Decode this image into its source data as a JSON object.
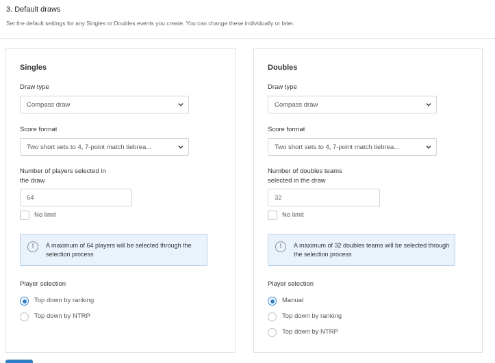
{
  "section": {
    "title": "3.  Default draws",
    "description": "Set the default settings for any Singles or Doubles events you create. You can change these individually or later."
  },
  "singles": {
    "title": "Singles",
    "draw_type_label": "Draw type",
    "draw_type_value": "Compass draw",
    "score_format_label": "Score format",
    "score_format_value": "Two short sets to 4, 7-point match tiebrea...",
    "count_label_line1": "Number of players selected in",
    "count_label_line2": "the draw",
    "count_value": "64",
    "no_limit_label": "No limit",
    "info_text": "A maximum of 64 players will be selected through the selection process",
    "player_selection_label": "Player selection",
    "options": [
      {
        "label": "Top down by ranking",
        "checked": true
      },
      {
        "label": "Top down by NTRP",
        "checked": false
      }
    ]
  },
  "doubles": {
    "title": "Doubles",
    "draw_type_label": "Draw type",
    "draw_type_value": "Compass draw",
    "score_format_label": "Score format",
    "score_format_value": "Two short sets to 4, 7-point match tiebrea...",
    "count_label_line1": "Number of doubles teams",
    "count_label_line2": "selected in the draw",
    "count_value": "32",
    "no_limit_label": "No limit",
    "info_text": "A maximum of 32 doubles teams will be selected through the selection process",
    "player_selection_label": "Player selection",
    "options": [
      {
        "label": "Manual",
        "checked": true
      },
      {
        "label": "Top down by ranking",
        "checked": false
      },
      {
        "label": "Top down by NTRP",
        "checked": false
      }
    ]
  },
  "colors": {
    "accent": "#2f7fc8",
    "info_bg": "#eaf2fb",
    "info_border": "#b6d0ea"
  },
  "icons": {
    "select_arrow": "chevron-down-icon",
    "info": "info-icon"
  }
}
